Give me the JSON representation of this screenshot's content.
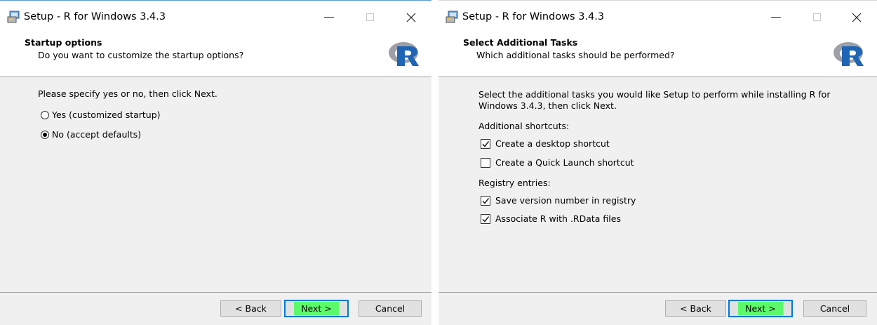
{
  "colors": {
    "default_button_border": "#0078d7",
    "next_highlight": "#5cfa6a",
    "r_logo_blue": "#1f65b5",
    "r_logo_gray": "#9da0a6"
  },
  "windows": [
    {
      "title": "Setup - R for Windows 3.4.3",
      "header": {
        "title": "Startup options",
        "subtitle": "Do you want to customize the startup options?"
      },
      "prompt": "Please specify yes or no, then click Next.",
      "options": [
        {
          "label": "Yes (customized startup)",
          "selected": false
        },
        {
          "label": "No (accept defaults)",
          "selected": true
        }
      ],
      "buttons": {
        "back": "< Back",
        "next": "Next >",
        "cancel": "Cancel"
      }
    },
    {
      "title": "Setup - R for Windows 3.4.3",
      "header": {
        "title": "Select Additional Tasks",
        "subtitle": "Which additional tasks should be performed?"
      },
      "prompt_line1": "Select the additional tasks you would like Setup to perform while installing R for",
      "prompt_line2": "Windows 3.4.3, then click Next.",
      "sections": [
        {
          "label": "Additional shortcuts:",
          "items": [
            {
              "label": "Create a desktop shortcut",
              "checked": true
            },
            {
              "label": "Create a Quick Launch shortcut",
              "checked": false
            }
          ]
        },
        {
          "label": "Registry entries:",
          "items": [
            {
              "label": "Save version number in registry",
              "checked": true
            },
            {
              "label": "Associate R with .RData files",
              "checked": true
            }
          ]
        }
      ],
      "buttons": {
        "back": "< Back",
        "next": "Next >",
        "cancel": "Cancel"
      }
    }
  ]
}
